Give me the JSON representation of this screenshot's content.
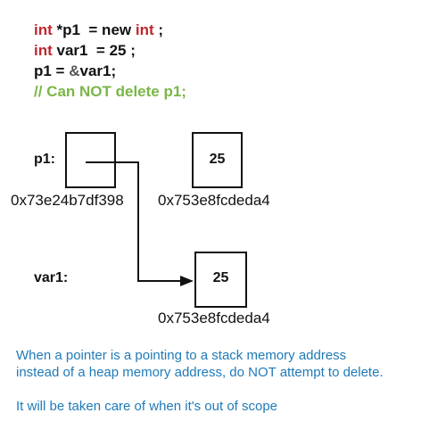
{
  "code": {
    "line1": {
      "kw1": "int",
      "mid": " *p1  = new ",
      "kw2": "int",
      "end": " ;"
    },
    "line2": {
      "kw": "int",
      "rest": " var1  = 25 ;"
    },
    "line3": {
      "start": "p1 = ",
      "amp": "&",
      "end": "var1;"
    },
    "line4": "// Can NOT delete p1;"
  },
  "diagram": {
    "p1_label": "p1:",
    "p1_address": "0x73e24b7df398",
    "heap_value": "25",
    "heap_address": "0x753e8fcdeda4",
    "var1_label": "var1:",
    "var1_value": "25",
    "var1_address": "0x753e8fcdeda4"
  },
  "notes": {
    "line1": "When a pointer is a pointing to a stack memory address",
    "line2": "instead of a heap memory address, do NOT attempt to delete.",
    "line3": "It will be taken care of when it's out of scope"
  },
  "colors": {
    "keyword": "#c0262d",
    "comment": "#7ab648",
    "note": "#1f7ab8"
  }
}
